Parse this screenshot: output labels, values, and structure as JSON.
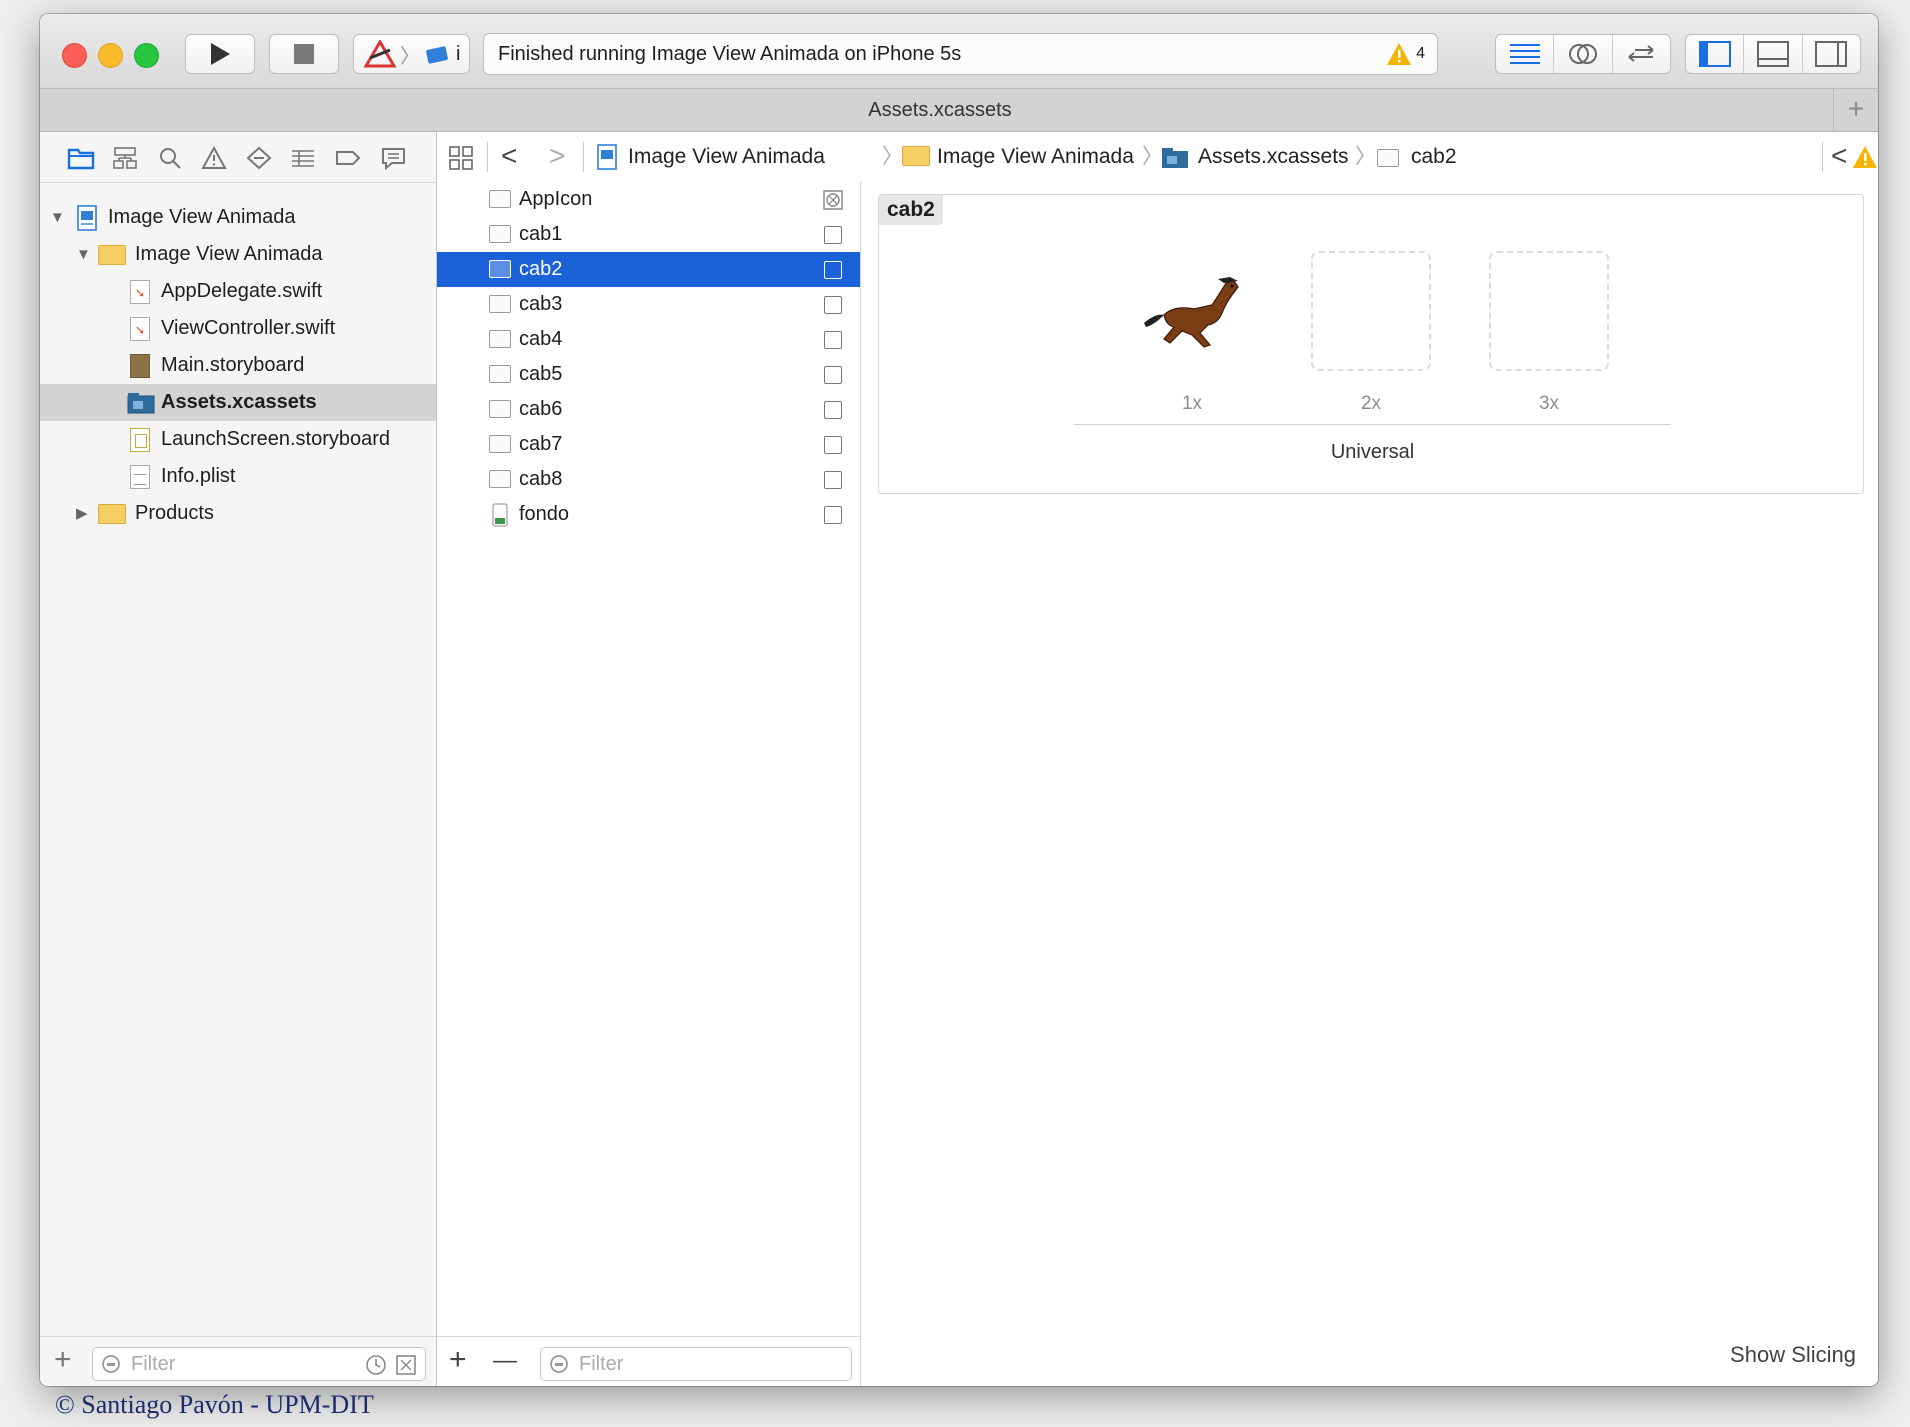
{
  "toolbar": {
    "status_text": "Finished running Image View Animada on iPhone 5s",
    "warning_count": "4",
    "scheme_suffix": "i"
  },
  "tab": {
    "title": "Assets.xcassets",
    "add_label": "+"
  },
  "breadcrumb": [
    "Image View Animada",
    "Image View Animada",
    "Assets.xcassets",
    "cab2"
  ],
  "navigator": {
    "items": [
      {
        "label": "Image View Animada",
        "icon": "project-icon"
      },
      {
        "label": "Image View Animada",
        "icon": "folder-icon"
      },
      {
        "label": "AppDelegate.swift",
        "icon": "swift-file-icon"
      },
      {
        "label": "ViewController.swift",
        "icon": "swift-file-icon"
      },
      {
        "label": "Main.storyboard",
        "icon": "storyboard-icon"
      },
      {
        "label": "Assets.xcassets",
        "icon": "asset-catalog-icon"
      },
      {
        "label": "LaunchScreen.storyboard",
        "icon": "storyboard-icon"
      },
      {
        "label": "Info.plist",
        "icon": "plist-icon"
      },
      {
        "label": "Products",
        "icon": "folder-icon"
      }
    ],
    "selected": "Assets.xcassets",
    "filter_placeholder": "Filter"
  },
  "assets": {
    "items": [
      "AppIcon",
      "cab1",
      "cab2",
      "cab3",
      "cab4",
      "cab5",
      "cab6",
      "cab7",
      "cab8",
      "fondo"
    ],
    "selected": "cab2",
    "filter_placeholder": "Filter",
    "add_label": "+",
    "remove_label": "—"
  },
  "editor": {
    "set_name": "cab2",
    "scales": [
      "1x",
      "2x",
      "3x"
    ],
    "device": "Universal",
    "show_slicing": "Show Slicing"
  },
  "credit": "© Santiago Pavón - UPM-DIT",
  "colors": {
    "selection": "#1b62d8",
    "warning": "#f5b400",
    "accent": "#1a6fe0"
  }
}
